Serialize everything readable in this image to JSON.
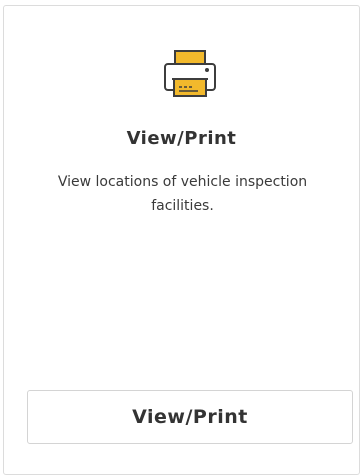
{
  "card": {
    "icon": "printer-icon",
    "title": "View/Print",
    "description": "View locations of vehicle inspection facilities.",
    "button_label": "View/Print"
  },
  "colors": {
    "accent": "#f2b92c",
    "icon_outline": "#3d3d3d",
    "border": "#dcdcdc",
    "text": "#333333"
  }
}
